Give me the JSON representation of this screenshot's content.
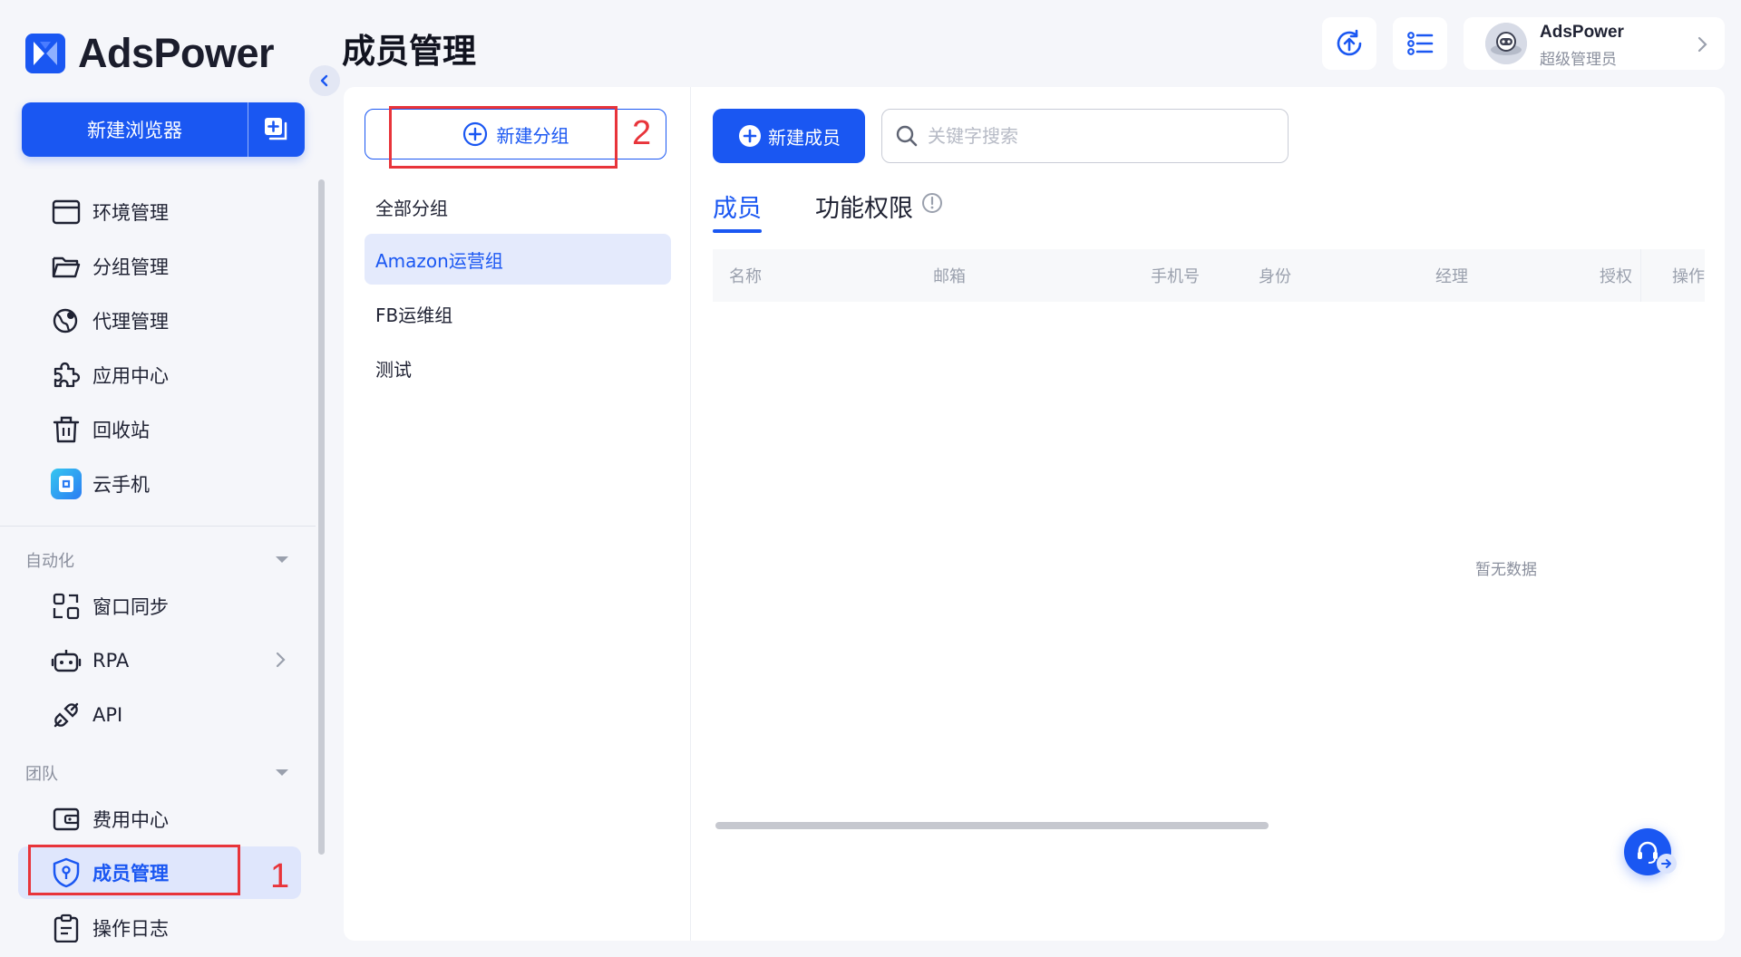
{
  "app": {
    "logo_text": "AdsPower"
  },
  "sidebar": {
    "new_browser_label": "新建浏览器",
    "items": [
      {
        "label": "环境管理",
        "icon": "browser-window-icon"
      },
      {
        "label": "分组管理",
        "icon": "folder-icon"
      },
      {
        "label": "代理管理",
        "icon": "globe-pin-icon"
      },
      {
        "label": "应用中心",
        "icon": "puzzle-icon"
      },
      {
        "label": "回收站",
        "icon": "trash-icon"
      },
      {
        "label": "云手机",
        "icon": "cloud-phone-icon"
      }
    ],
    "automation": {
      "label": "自动化",
      "items": [
        {
          "label": "窗口同步",
          "icon": "window-sync-icon"
        },
        {
          "label": "RPA",
          "icon": "robot-icon"
        },
        {
          "label": "API",
          "icon": "plug-icon"
        }
      ]
    },
    "team": {
      "label": "团队",
      "items": [
        {
          "label": "费用中心",
          "icon": "wallet-icon"
        },
        {
          "label": "成员管理",
          "icon": "shield-icon",
          "active": true
        },
        {
          "label": "操作日志",
          "icon": "clipboard-icon"
        }
      ]
    }
  },
  "annotations": {
    "step1": "1",
    "step2": "2",
    "color": "#e8343a"
  },
  "header": {
    "title": "成员管理",
    "user": {
      "name": "AdsPower",
      "role": "超级管理员"
    }
  },
  "groups": {
    "new_group_label": "新建分组",
    "items": [
      "全部分组",
      "Amazon运营组",
      "FB运维组",
      "测试"
    ],
    "active_index": 1
  },
  "members": {
    "new_member_label": "新建成员",
    "search_placeholder": "关键字搜索",
    "tabs": [
      "成员",
      "功能权限"
    ],
    "active_tab": 0,
    "columns": [
      "名称",
      "邮箱",
      "手机号",
      "身份",
      "经理",
      "授权",
      "操作"
    ],
    "empty_text": "暂无数据"
  },
  "colors": {
    "accent": "#1a57f2",
    "active_bg": "#e4eafc",
    "page_bg": "#f5f6fa"
  }
}
